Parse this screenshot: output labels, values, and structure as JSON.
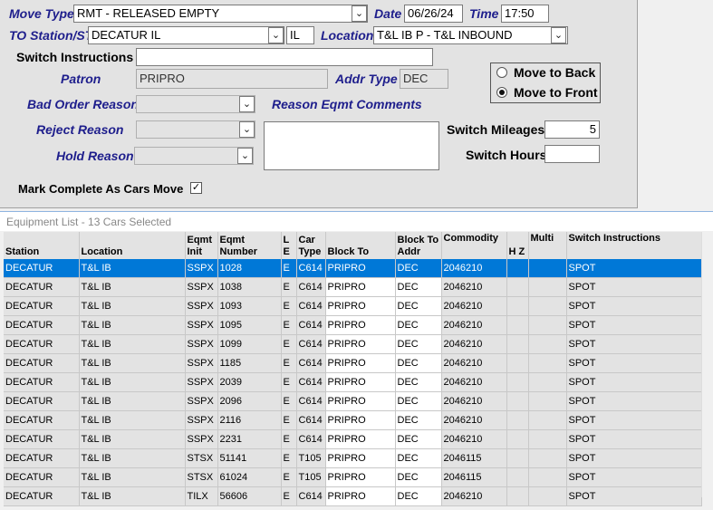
{
  "form": {
    "move_type_label": "Move Type",
    "move_type_value": "RMT - RELEASED EMPTY",
    "date_label": "Date",
    "date_value": "06/26/24",
    "time_label": "Time",
    "time_value": "17:50",
    "to_station_label": "TO Station/ST",
    "to_station_value": "DECATUR IL",
    "state_value": "IL",
    "location_label": "Location",
    "location_value": "T&L IB P - T&L INBOUND",
    "switch_instructions_label": "Switch Instructions",
    "switch_instructions_value": "",
    "patron_label": "Patron",
    "patron_value": "PRIPRO",
    "addr_type_label": "Addr Type",
    "addr_type_value": "DEC",
    "move_to_back_label": "Move to Back",
    "move_to_front_label": "Move to Front",
    "bad_order_label": "Bad Order Reason",
    "reason_comments_label": "Reason Eqmt Comments",
    "reject_label": "Reject Reason",
    "hold_label": "Hold Reason",
    "switch_mileages_label": "Switch Mileages",
    "switch_mileages_value": "5",
    "switch_hours_label": "Switch Hours",
    "switch_hours_value": "",
    "mark_complete_label": "Mark Complete As Cars Move",
    "mark_complete_checked": true,
    "move_selected": "front"
  },
  "equipment": {
    "title": "Equipment List - 13 Cars Selected",
    "headers": {
      "station": "Station",
      "location": "Location",
      "eqmt_init": "Eqmt Init",
      "eqmt_number": "Eqmt Number",
      "le": "L E",
      "car_type": "Car Type",
      "block_to": "Block To",
      "block_to_addr": "Block To Addr",
      "commodity": "Commodity",
      "hz": "H Z",
      "multi": "Multi",
      "switch_instructions": "Switch Instructions"
    },
    "rows": [
      [
        "DECATUR",
        "T&L IB",
        "SSPX",
        "1028",
        "E",
        "C614",
        "PRIPRO",
        "DEC",
        "2046210",
        "",
        "",
        "SPOT"
      ],
      [
        "DECATUR",
        "T&L IB",
        "SSPX",
        "1038",
        "E",
        "C614",
        "PRIPRO",
        "DEC",
        "2046210",
        "",
        "",
        "SPOT"
      ],
      [
        "DECATUR",
        "T&L IB",
        "SSPX",
        "1093",
        "E",
        "C614",
        "PRIPRO",
        "DEC",
        "2046210",
        "",
        "",
        "SPOT"
      ],
      [
        "DECATUR",
        "T&L IB",
        "SSPX",
        "1095",
        "E",
        "C614",
        "PRIPRO",
        "DEC",
        "2046210",
        "",
        "",
        "SPOT"
      ],
      [
        "DECATUR",
        "T&L IB",
        "SSPX",
        "1099",
        "E",
        "C614",
        "PRIPRO",
        "DEC",
        "2046210",
        "",
        "",
        "SPOT"
      ],
      [
        "DECATUR",
        "T&L IB",
        "SSPX",
        "1185",
        "E",
        "C614",
        "PRIPRO",
        "DEC",
        "2046210",
        "",
        "",
        "SPOT"
      ],
      [
        "DECATUR",
        "T&L IB",
        "SSPX",
        "2039",
        "E",
        "C614",
        "PRIPRO",
        "DEC",
        "2046210",
        "",
        "",
        "SPOT"
      ],
      [
        "DECATUR",
        "T&L IB",
        "SSPX",
        "2096",
        "E",
        "C614",
        "PRIPRO",
        "DEC",
        "2046210",
        "",
        "",
        "SPOT"
      ],
      [
        "DECATUR",
        "T&L IB",
        "SSPX",
        "2116",
        "E",
        "C614",
        "PRIPRO",
        "DEC",
        "2046210",
        "",
        "",
        "SPOT"
      ],
      [
        "DECATUR",
        "T&L IB",
        "SSPX",
        "2231",
        "E",
        "C614",
        "PRIPRO",
        "DEC",
        "2046210",
        "",
        "",
        "SPOT"
      ],
      [
        "DECATUR",
        "T&L IB",
        "STSX",
        "51141",
        "E",
        "T105",
        "PRIPRO",
        "DEC",
        "2046115",
        "",
        "",
        "SPOT"
      ],
      [
        "DECATUR",
        "T&L IB",
        "STSX",
        "61024",
        "E",
        "T105",
        "PRIPRO",
        "DEC",
        "2046115",
        "",
        "",
        "SPOT"
      ],
      [
        "DECATUR",
        "T&L IB",
        "TILX",
        "56606",
        "E",
        "C614",
        "PRIPRO",
        "DEC",
        "2046210",
        "",
        "",
        "SPOT"
      ]
    ],
    "selected_row": 0
  },
  "colors": {
    "label_blue": "#1e1e8c",
    "selection": "#0078d7"
  }
}
